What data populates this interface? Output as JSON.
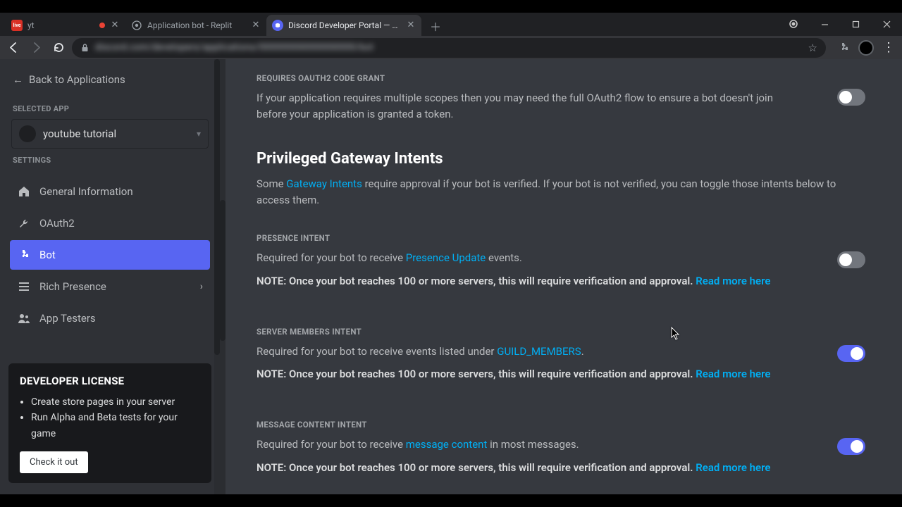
{
  "browser": {
    "tabs": [
      {
        "title": "yt",
        "favicon_color": "#d93025",
        "favicon_text": "live"
      },
      {
        "title": "Application bot - Replit"
      },
      {
        "title": "Discord Developer Portal — My"
      }
    ],
    "url_obscured": "discord.com/developers/applications/000000000000000000/bot"
  },
  "sidebar": {
    "back_label": "Back to Applications",
    "selected_app_label": "SELECTED APP",
    "selected_app_name": "youtube tutorial",
    "settings_label": "SETTINGS",
    "items": [
      {
        "label": "General Information"
      },
      {
        "label": "OAuth2"
      },
      {
        "label": "Bot"
      },
      {
        "label": "Rich Presence"
      },
      {
        "label": "App Testers"
      }
    ]
  },
  "dev_license": {
    "title": "DEVELOPER LICENSE",
    "bullets": [
      "Create store pages in your server",
      "Run Alpha and Beta tests for your game"
    ],
    "cta": "Check it out"
  },
  "content": {
    "oauth2": {
      "heading": "REQUIRES OAUTH2 CODE GRANT",
      "body": "If your application requires multiple scopes then you may need the full OAuth2 flow to ensure a bot doesn't join before your application is granted a token."
    },
    "intents_heading": "Privileged Gateway Intents",
    "intents_body_pre": "Some ",
    "intents_body_link": "Gateway Intents",
    "intents_body_post": " require approval if your bot is verified. If your bot is not verified, you can toggle those intents below to access them.",
    "presence": {
      "heading": "PRESENCE INTENT",
      "body_pre": "Required for your bot to receive ",
      "body_link": "Presence Update",
      "body_post": " events.",
      "note": "NOTE: Once your bot reaches 100 or more servers, this will require verification and approval. ",
      "note_link": "Read more here"
    },
    "members": {
      "heading": "SERVER MEMBERS INTENT",
      "body_pre": "Required for your bot to receive events listed under ",
      "body_link": "GUILD_MEMBERS",
      "body_post": ".",
      "note": "NOTE: Once your bot reaches 100 or more servers, this will require verification and approval. ",
      "note_link": "Read more here"
    },
    "message": {
      "heading": "MESSAGE CONTENT INTENT",
      "body_pre": "Required for your bot to receive ",
      "body_link": "message content",
      "body_post": " in most messages.",
      "note": "NOTE: Once your bot reaches 100 or more servers, this will require verification and approval. ",
      "note_link": "Read more here"
    }
  },
  "toggles": {
    "oauth2": false,
    "presence": false,
    "members": true,
    "message": true
  }
}
